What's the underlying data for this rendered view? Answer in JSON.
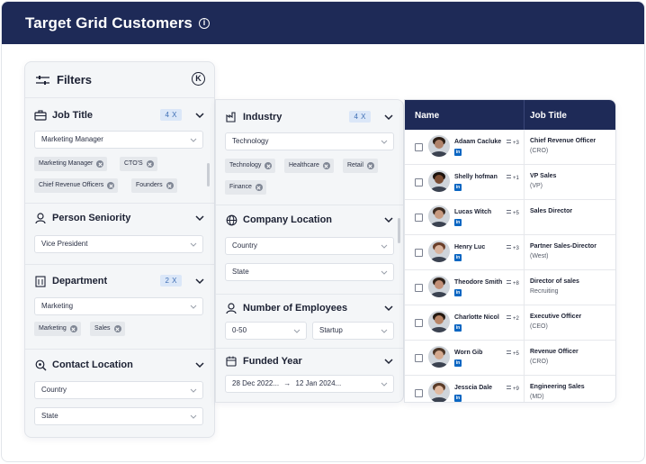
{
  "header": {
    "title": "Target Grid Customers"
  },
  "filters": {
    "title": "Filters",
    "job_title": {
      "label": "Job Title",
      "badge": "4 X",
      "select": "Marketing Manager",
      "chips": [
        "Marketing Manager",
        "CTO'S",
        "Chief Revenue Officers",
        "Founders"
      ]
    },
    "seniority": {
      "label": "Person Seniority",
      "select": "Vice President"
    },
    "department": {
      "label": "Department",
      "badge": "2 X",
      "select": "Marketing",
      "chips": [
        "Marketing",
        "Sales"
      ]
    },
    "contact_location": {
      "label": "Contact Location",
      "country": "Country",
      "state": "State"
    }
  },
  "filters2": {
    "industry": {
      "label": "Industry",
      "badge": "4 X",
      "select": "Technology",
      "chips": [
        "Technology",
        "Healthcare",
        "Retail",
        "Finance"
      ]
    },
    "company_location": {
      "label": "Company Location",
      "country": "Country",
      "state": "State"
    },
    "employees": {
      "label": "Number of Employees",
      "range": "0-50",
      "stage": "Startup"
    },
    "funded_year": {
      "label": "Funded Year",
      "from": "28 Dec 2022...",
      "arrow": "→",
      "to": "12 Jan 2024..."
    }
  },
  "table": {
    "headers": {
      "name": "Name",
      "job_title": "Job Title"
    },
    "rows": [
      {
        "name": "Adaam Cacluke",
        "count": "+3",
        "title": "Chief Revenue Officer",
        "sub": "(CRO)",
        "skin": "#b0836b",
        "hair": "#2b1d14"
      },
      {
        "name": "Shelly hofman",
        "count": "+1",
        "title": "VP Sales",
        "sub": "(VP)",
        "skin": "#7a4c33",
        "hair": "#1b120d"
      },
      {
        "name": "Lucas Witch",
        "count": "+5",
        "title": "Sales Director",
        "sub": "",
        "skin": "#c79a80",
        "hair": "#3a2a20"
      },
      {
        "name": "Henry Luc",
        "count": "+3",
        "title": "Partner Sales-Director",
        "sub": "(West)",
        "skin": "#d9b39d",
        "hair": "#6b3f2a"
      },
      {
        "name": "Theodore Smith",
        "count": "+8",
        "title": "Director of sales",
        "sub": "Recruiting",
        "skin": "#c29078",
        "hair": "#2e2119"
      },
      {
        "name": "Charlotte Nicol",
        "count": "+2",
        "title": "Executive Officer",
        "sub": "(CEO)",
        "skin": "#b88466",
        "hair": "#241911"
      },
      {
        "name": "Worn Gib",
        "count": "+5",
        "title": "Revenue Officer",
        "sub": "(CRO)",
        "skin": "#d4a98f",
        "hair": "#4b3526"
      },
      {
        "name": "Jesscia Dale",
        "count": "+9",
        "title": "Engineering Sales",
        "sub": "(MD)",
        "skin": "#e0b9a0",
        "hair": "#5a3b28"
      }
    ]
  },
  "icons": {
    "linkedin": "in",
    "k": "K"
  },
  "colors": {
    "navy": "#1e2a57",
    "badge_bg": "#dbe7f8",
    "badge_text": "#3f6fb5",
    "linkedin": "#0a66c2"
  }
}
